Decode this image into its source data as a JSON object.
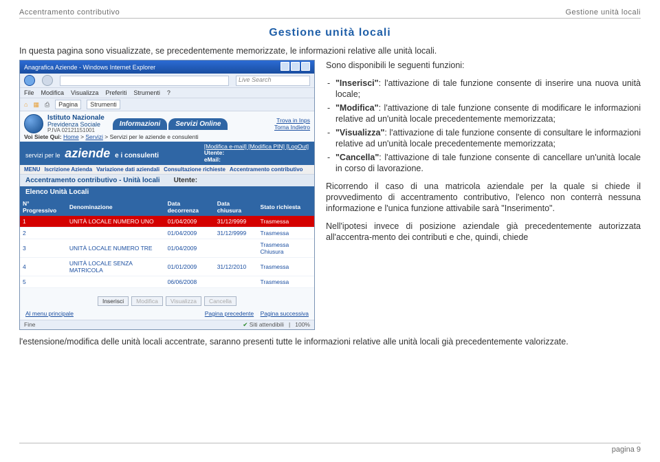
{
  "header": {
    "left": "Accentramento contributivo",
    "right": "Gestione unità locali"
  },
  "title": "Gestione unità locali",
  "intro": "In questa pagina sono visualizzate, se precedentemente memorizzate, le informazioni relative alle unità locali.",
  "right_col": {
    "lead": "Sono disponibili le seguenti funzioni:",
    "items": [
      {
        "kw": "\"Inserisci\"",
        "body": ": l'attivazione di tale funzione consente di inserire una nuova unità locale;"
      },
      {
        "kw": "\"Modifica\"",
        "body": ": l'attivazione di tale funzione consente di modificare le informazioni relative ad un'unità locale precedentemente memorizzata;"
      },
      {
        "kw": "\"Visualizza\"",
        "body": ": l'attivazione di tale funzione consente di consultare le informazioni relative ad un'unità locale precedentemente memorizzata;"
      },
      {
        "kw": "\"Cancella\"",
        "body": ": l'attivazione di tale funzione consente di cancellare un'unità locale in corso di lavorazione."
      }
    ],
    "para2": "Ricorrendo il caso di una matricola aziendale per la quale si chiede il provvedimento di accentramento contributivo, l'elenco non conterrà nessuna informazione e l'unica funzione attivabile sarà \"Inserimento\".",
    "para3": "Nell'ipotesi invece di posizione aziendale già precedentemente autorizzata all'accentra-mento dei contributi e che, quindi, chiede"
  },
  "bottom": "l'estensione/modifica delle unità locali accentrate, saranno presenti tutte le informazioni relative alle unità locali già precedentemente valorizzate.",
  "footer": "pagina 9",
  "shot": {
    "win_title": "Anagrafica Aziende - Windows Internet Explorer",
    "menubar": [
      "File",
      "Modifica",
      "Visualizza",
      "Preferiti",
      "Strumenti",
      "?"
    ],
    "search_ph": "Live Search",
    "ie_btns": [
      "Pagina",
      "Strumenti"
    ],
    "brand": {
      "l1": "Istituto Nazionale",
      "l2": "Previdenza Sociale",
      "l3": "P.IVA 02121151001"
    },
    "tabs": [
      "Informazioni",
      "Servizi Online"
    ],
    "quicklinks": {
      "trova": "Trova in Inps",
      "indietro": "Torna Indietro"
    },
    "breadcrumb_label": "Voi Siete Qui:",
    "breadcrumb": [
      "Home",
      "Servizi",
      "Servizi per le aziende e consulenti"
    ],
    "strip": {
      "sp": "servizi per le",
      "az": "aziende",
      "cons": "e i consulenti",
      "edit": "[Modifica e-mail] [Modifica PIN] [LogOut]",
      "utente": "Utente:",
      "email": "eMail:"
    },
    "menu": [
      "MENU",
      "Iscrizione Azienda",
      "Variazione dati aziendali",
      "Consultazione richieste",
      "Accentramento contributivo"
    ],
    "sec": {
      "title": "Accentramento contributivo - Unità locali",
      "utente": "Utente:"
    },
    "tbl_title": "Elenco Unità Locali",
    "cols": [
      "N° Progressivo",
      "Denominazione",
      "Data decorrenza",
      "Data chiusura",
      "Stato richiesta"
    ],
    "rows": [
      {
        "n": "1",
        "den": "UNITÀ LOCALE NUMERO UNO",
        "d1": "01/04/2009",
        "d2": "31/12/9999",
        "st": "Trasmessa",
        "hl": true
      },
      {
        "n": "2",
        "den": "",
        "d1": "01/04/2009",
        "d2": "31/12/9999",
        "st": "Trasmessa"
      },
      {
        "n": "3",
        "den": "UNITÀ LOCALE NUMERO TRE",
        "d1": "01/04/2009",
        "d2": "",
        "st": "Trasmessa Chiusura"
      },
      {
        "n": "4",
        "den": "UNITÀ LOCALE SENZA MATRICOLA",
        "d1": "01/01/2009",
        "d2": "31/12/2010",
        "st": "Trasmessa"
      },
      {
        "n": "5",
        "den": "",
        "d1": "06/06/2008",
        "d2": "",
        "st": "Trasmessa"
      }
    ],
    "btns": [
      "Inserisci",
      "Modifica",
      "Visualizza",
      "Cancella"
    ],
    "foot": {
      "menu": "Al menu principale",
      "prev": "Pagina precedente",
      "next": "Pagina successiva"
    },
    "status": {
      "left": "Fine",
      "mid": "Siti attendibili",
      "zoom": "100%"
    }
  }
}
